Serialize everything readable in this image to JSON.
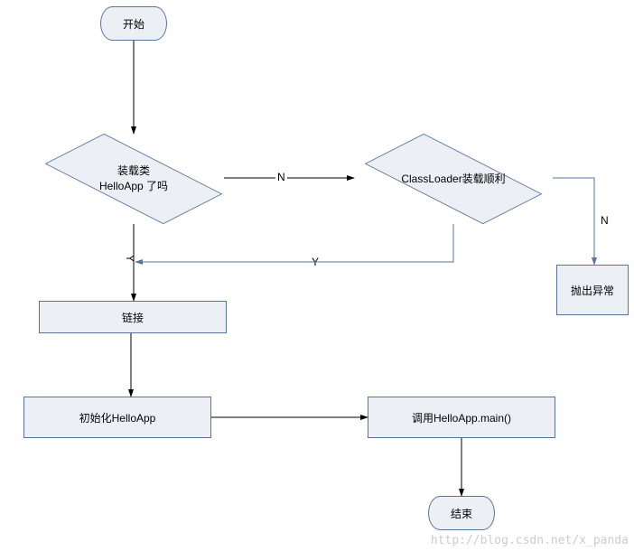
{
  "nodes": {
    "start": "开始",
    "decision_loaded": "装载类\nHelloApp 了吗",
    "decision_loader_ok": "ClassLoader装载顺利",
    "link": "链接",
    "throw_exc": "抛出异常",
    "init": "初始化HelloApp",
    "invoke_main": "调用HelloApp.main()",
    "end": "结束"
  },
  "edges": {
    "loaded_no": "N",
    "loaded_yes": "Y",
    "loader_ok_yes": "Y",
    "loader_ok_no": "N"
  },
  "chart_data": {
    "type": "flowchart",
    "nodes": [
      {
        "id": "start",
        "type": "terminator",
        "label": "开始"
      },
      {
        "id": "d1",
        "type": "decision",
        "label": "装载类 HelloApp 了吗"
      },
      {
        "id": "d2",
        "type": "decision",
        "label": "ClassLoader装载顺利"
      },
      {
        "id": "link",
        "type": "process",
        "label": "链接"
      },
      {
        "id": "exc",
        "type": "process",
        "label": "抛出异常"
      },
      {
        "id": "init",
        "type": "process",
        "label": "初始化HelloApp"
      },
      {
        "id": "main",
        "type": "process",
        "label": "调用HelloApp.main()"
      },
      {
        "id": "end",
        "type": "terminator",
        "label": "结束"
      }
    ],
    "edges": [
      {
        "from": "start",
        "to": "d1",
        "label": ""
      },
      {
        "from": "d1",
        "to": "d2",
        "label": "N"
      },
      {
        "from": "d1",
        "to": "link",
        "label": "Y"
      },
      {
        "from": "d2",
        "to": "link",
        "label": "Y"
      },
      {
        "from": "d2",
        "to": "exc",
        "label": "N"
      },
      {
        "from": "link",
        "to": "init",
        "label": ""
      },
      {
        "from": "init",
        "to": "main",
        "label": ""
      },
      {
        "from": "main",
        "to": "end",
        "label": ""
      }
    ]
  },
  "watermark": "http://blog.csdn.net/x_panda"
}
